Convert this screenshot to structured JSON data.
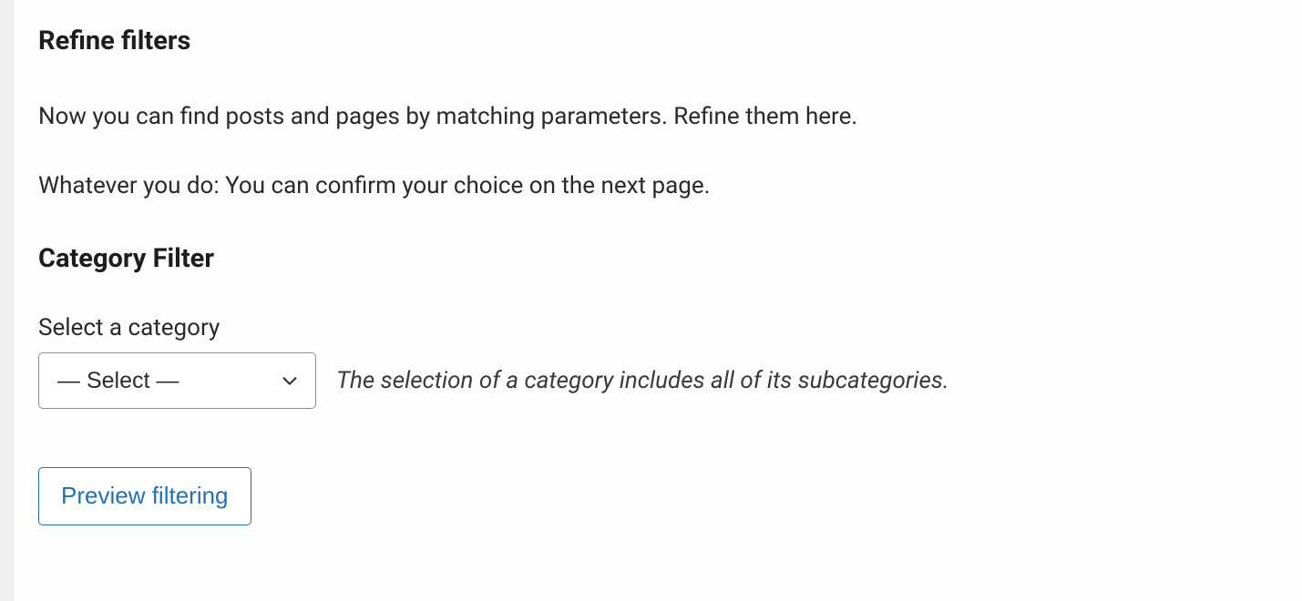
{
  "heading_main": "Refine filters",
  "desc_1": "Now you can find posts and pages by matching parameters. Refine them here.",
  "desc_2": "Whatever you do: You can confirm your choice on the next page.",
  "heading_sub": "Category Filter",
  "category": {
    "label": "Select a category",
    "selected": "— Select —",
    "hint": "The selection of a category includes all of its subcategories."
  },
  "preview_button": "Preview filtering"
}
